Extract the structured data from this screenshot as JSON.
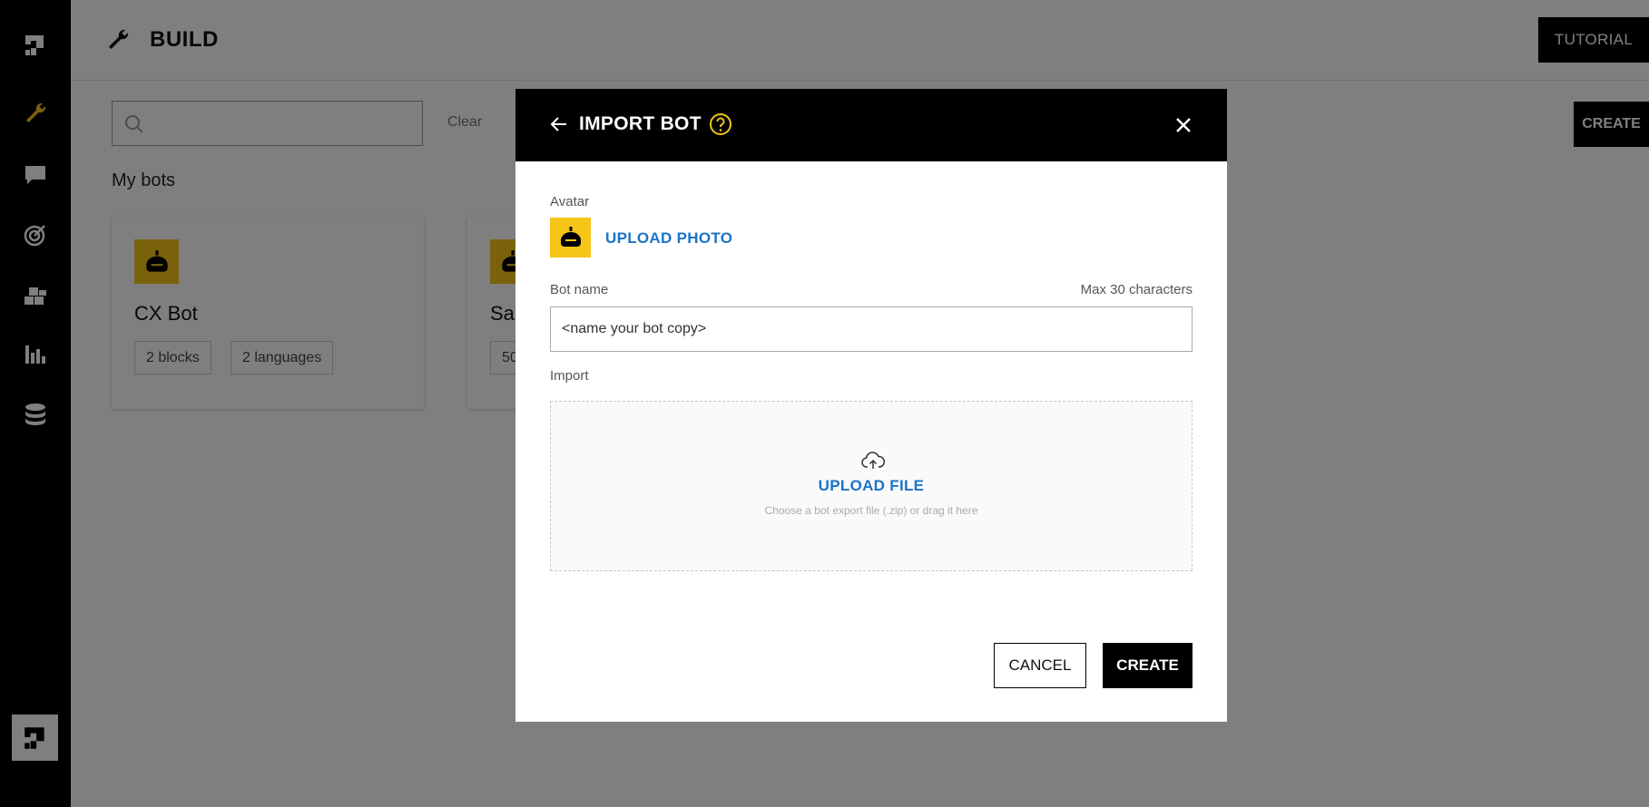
{
  "sidebar": {
    "items": [
      {
        "icon": "logo-icon",
        "active": false
      },
      {
        "icon": "wrench-icon",
        "active": true
      },
      {
        "icon": "chat-icon",
        "active": false
      },
      {
        "icon": "target-icon",
        "active": false
      },
      {
        "icon": "blocks-icon",
        "active": false
      },
      {
        "icon": "bar-chart-icon",
        "active": false
      },
      {
        "icon": "database-icon",
        "active": false
      }
    ],
    "bottom_icon": "logo-icon"
  },
  "header": {
    "title": "BUILD",
    "tutorial_label": "TUTORIAL"
  },
  "search": {
    "placeholder": "",
    "clear_label": "Clear"
  },
  "create_top_label": "CREATE",
  "section_title": "My bots",
  "bots": [
    {
      "name": "CX Bot",
      "tags": [
        "2 blocks",
        "2 languages"
      ]
    },
    {
      "name": "Sa",
      "tags": [
        "50"
      ]
    }
  ],
  "modal": {
    "title": "IMPORT BOT",
    "avatar_label": "Avatar",
    "upload_photo_label": "UPLOAD PHOTO",
    "bot_name_label": "Bot name",
    "max_chars_label": "Max 30 characters",
    "bot_name_value": "<name your bot copy>",
    "import_label": "Import",
    "upload_file_label": "UPLOAD FILE",
    "upload_hint": "Choose a bot export file (.zip) or drag it here",
    "cancel_label": "CANCEL",
    "create_label": "CREATE"
  },
  "colors": {
    "accent": "#f5c518",
    "link": "#1a73c8",
    "overlay": "rgba(0,0,0,0.5)"
  }
}
